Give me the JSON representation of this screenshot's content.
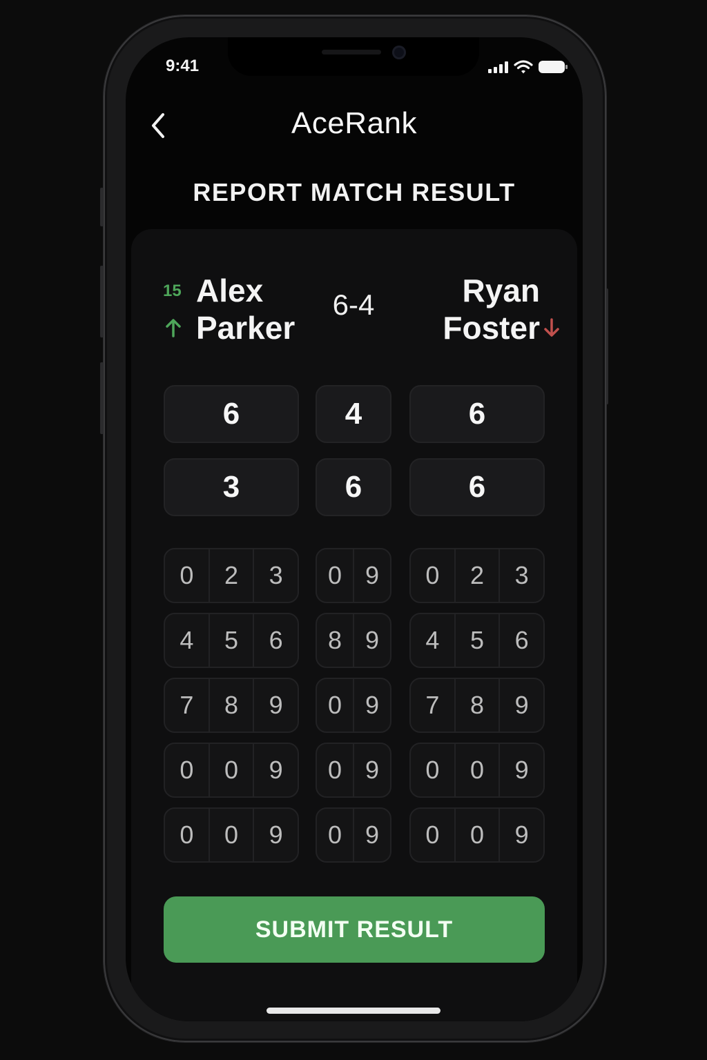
{
  "status_bar": {
    "time": "9:41"
  },
  "header": {
    "app_title": "AceRank",
    "page_title": "REPORT MATCH RESULT"
  },
  "match": {
    "player1": {
      "name_line1": "Alex",
      "name_line2": "Parker",
      "rank": "15",
      "trend_icon": "arrow-up-icon",
      "trend_color": "#4ea65a"
    },
    "player2": {
      "name_line1": "Ryan",
      "name_line2": "Foster",
      "trend_icon": "arrow-down-icon",
      "trend_color": "#c0504d"
    },
    "summary_score": "6-4"
  },
  "set_scores": [
    [
      "6",
      "4",
      "6"
    ],
    [
      "3",
      "6",
      "6"
    ]
  ],
  "digit_pickers": [
    [
      [
        "0",
        "2",
        "3"
      ],
      [
        "0",
        "9"
      ],
      [
        "0",
        "2",
        "3"
      ]
    ],
    [
      [
        "4",
        "5",
        "6"
      ],
      [
        "8",
        "9"
      ],
      [
        "4",
        "5",
        "6"
      ]
    ],
    [
      [
        "7",
        "8",
        "9"
      ],
      [
        "0",
        "9"
      ],
      [
        "7",
        "8",
        "9"
      ]
    ],
    [
      [
        "0",
        "0",
        "9"
      ],
      [
        "0",
        "9"
      ],
      [
        "0",
        "0",
        "9"
      ]
    ],
    [
      [
        "0",
        "0",
        "9"
      ],
      [
        "0",
        "9"
      ],
      [
        "0",
        "0",
        "9"
      ]
    ]
  ],
  "submit": {
    "label": "SUBMIT RESULT",
    "color": "#4a9a56"
  }
}
